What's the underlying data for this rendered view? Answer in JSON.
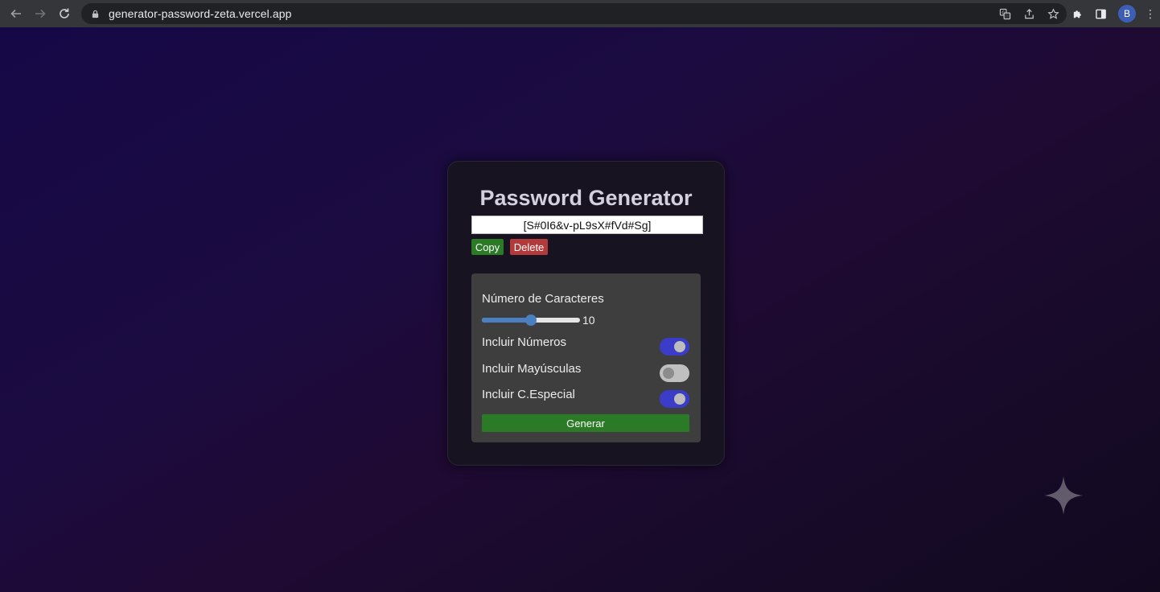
{
  "browser": {
    "url": "generator-password-zeta.vercel.app",
    "profile_initial": "B",
    "kebab": "⋮"
  },
  "app": {
    "title": "Password Generator",
    "password_value": "[S#0I6&v-pL9sX#fVd#Sg]",
    "copy_label": "Copy",
    "delete_label": "Delete",
    "length_label": "Número de Caracteres",
    "length_value": "10",
    "length_fraction": 0.5,
    "numbers_label": "Incluir Números",
    "numbers_on": true,
    "uppercase_label": "Incluir Mayúsculas",
    "uppercase_on": false,
    "special_label": "Incluir C.Especial",
    "special_on": true,
    "generate_label": "Generar"
  },
  "colors": {
    "accent_toggle": "#3b3dc9",
    "copy_green": "#2b7a25",
    "delete_red": "#b33a3a",
    "slider_blue": "#4a7fc0"
  },
  "icons": {
    "back": "arrow-left-icon",
    "forward": "arrow-right-icon",
    "reload": "reload-icon",
    "lock": "lock-icon",
    "translate": "translate-icon",
    "share": "share-icon",
    "bookmark": "star-icon",
    "extensions": "puzzle-icon",
    "sidepanel": "side-panel-icon",
    "sparkle": "sparkle-icon"
  }
}
